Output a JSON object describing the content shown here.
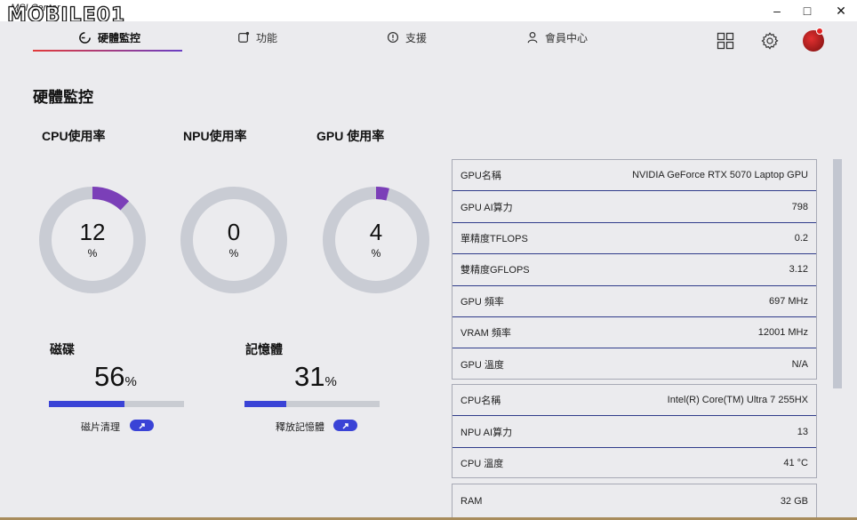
{
  "window": {
    "app_name": "MSI Center",
    "watermark": "MOBILE01",
    "minimize": "–",
    "maximize": "□",
    "close": "✕"
  },
  "nav": {
    "tabs": [
      {
        "label": "硬體監控",
        "icon": "monitor-gauge-icon",
        "active": true
      },
      {
        "label": "功能",
        "icon": "feature-icon",
        "active": false
      },
      {
        "label": "支援",
        "icon": "support-icon",
        "active": false
      },
      {
        "label": "會員中心",
        "icon": "member-icon",
        "active": false
      }
    ],
    "right_icons": [
      "grid-icon",
      "gear-icon",
      "avatar"
    ]
  },
  "page": {
    "title": "硬體監控"
  },
  "gauges": [
    {
      "label": "CPU使用率",
      "value": "12",
      "unit": "%",
      "percent": 12
    },
    {
      "label": "NPU使用率",
      "value": "0",
      "unit": "%",
      "percent": 0
    },
    {
      "label": "GPU 使用率",
      "value": "4",
      "unit": "%",
      "percent": 4
    }
  ],
  "storage": [
    {
      "label": "磁碟",
      "value": "56",
      "unit": "%",
      "percent": 56,
      "action_label": "磁片清理"
    },
    {
      "label": "記憶體",
      "value": "31",
      "unit": "%",
      "percent": 31,
      "action_label": "釋放記憶體"
    }
  ],
  "gpu_panel": [
    {
      "key": "GPU名稱",
      "value": "NVIDIA GeForce RTX 5070 Laptop GPU"
    },
    {
      "key": "GPU AI算力",
      "value": "798"
    },
    {
      "key": "單精度TFLOPS",
      "value": "0.2"
    },
    {
      "key": "雙精度GFLOPS",
      "value": "3.12"
    },
    {
      "key": "GPU 頻率",
      "value": "697 MHz"
    },
    {
      "key": "VRAM 頻率",
      "value": "12001 MHz"
    },
    {
      "key": "GPU 溫度",
      "value": "N/A"
    }
  ],
  "cpu_panel": [
    {
      "key": "CPU名稱",
      "value": "Intel(R) Core(TM) Ultra 7 255HX"
    },
    {
      "key": "NPU AI算力",
      "value": "13"
    },
    {
      "key": "CPU 溫度",
      "value": "41 °C"
    }
  ],
  "ram_panel": [
    {
      "key": "RAM",
      "value": "32 GB"
    }
  ],
  "colors": {
    "accent_blue": "#3a43d6",
    "gauge_fill": "#7b3fb8",
    "gauge_track": "#c9ccd4",
    "tab_underline_start": "#e23b3b",
    "tab_underline_end": "#6a3fc4"
  }
}
